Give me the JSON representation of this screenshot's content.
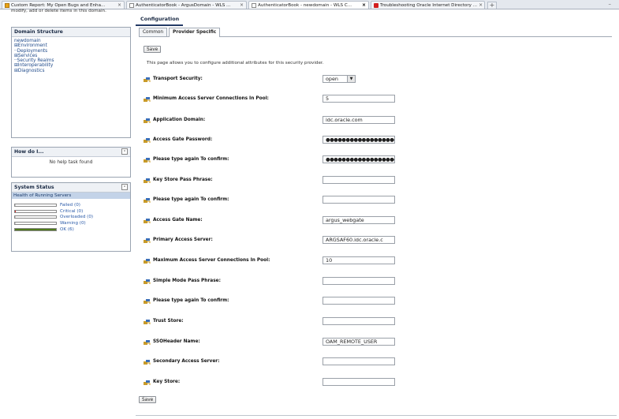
{
  "browser": {
    "tabs": [
      {
        "label": "Custom Report: My Open Bugs and Enha...",
        "icon_color": "#e8a317"
      },
      {
        "label": "AuthenticatorBook - ArgusDomain - WLS ...",
        "icon_color": "#ffffff"
      },
      {
        "label": "AuthenticatorBook - newdomain - WLS C...",
        "icon_color": "#ffffff"
      },
      {
        "label": "Troubleshooting Oracle Internet Directory ...",
        "icon_color": "#d21e1e"
      }
    ],
    "new_tab": "+",
    "close_glyph": "×",
    "minimize": "–"
  },
  "sidebar": {
    "top_text": "modify, add or delete items in this domain.",
    "domain_structure": {
      "title": "Domain Structure",
      "items": [
        "newdomain",
        "⊞Environment",
        "··Deployments",
        "⊞Services",
        "··Security Realms",
        "⊞Interoperability",
        "⊞Diagnostics"
      ]
    },
    "how_do_i": {
      "title": "How do I...",
      "collapse": "⊟",
      "text": "No help task found"
    },
    "system_status": {
      "title": "System Status",
      "collapse": "⊟",
      "health_label": "Health of Running Servers",
      "rows": [
        {
          "label": "Failed (0)",
          "color": "#d0d0d0",
          "fraction": 0
        },
        {
          "label": "Critical (0)",
          "color": "#cc2222",
          "fraction": 0
        },
        {
          "label": "Overloaded (0)",
          "color": "#d0d0d0",
          "fraction": 0
        },
        {
          "label": "Warning (0)",
          "color": "#d0d0d0",
          "fraction": 0
        },
        {
          "label": "OK (6)",
          "color": "#4f7a1a",
          "fraction": 1
        }
      ]
    }
  },
  "main": {
    "title": "Configuration",
    "tabs": [
      {
        "label": "Common",
        "selected": false
      },
      {
        "label": "Provider Specific",
        "selected": true
      }
    ],
    "save_label": "Save",
    "description": "This page allows you to configure additional attributes for this security provider.",
    "fields": [
      {
        "label": "Transport Security:",
        "type": "select",
        "value": "open",
        "arrow": "▼"
      },
      {
        "label": "Minimum Access Server Connections In Pool:",
        "type": "text",
        "value": "5"
      },
      {
        "label": "Application Domain:",
        "type": "text",
        "value": "idc.oracle.com"
      },
      {
        "label": "Access Gate Password:",
        "type": "password",
        "value": "●●●●●●●●●●●●●●●●●●"
      },
      {
        "label": "Please type again To confirm:",
        "type": "password",
        "value": "●●●●●●●●●●●●●●●●●●"
      },
      {
        "label": "Key Store Pass Phrase:",
        "type": "text",
        "value": ""
      },
      {
        "label": "Please type again To confirm:",
        "type": "text",
        "value": ""
      },
      {
        "label": "Access Gate Name:",
        "type": "text",
        "value": "argus_webgate"
      },
      {
        "label": "Primary Access Server:",
        "type": "text",
        "value": "ARGSAF60.idc.oracle.c"
      },
      {
        "label": "Maximum Access Server Connections In Pool:",
        "type": "text",
        "value": "10"
      },
      {
        "label": "Simple Mode Pass Phrase:",
        "type": "text",
        "value": ""
      },
      {
        "label": "Please type again To confirm:",
        "type": "text",
        "value": ""
      },
      {
        "label": "Trust Store:",
        "type": "text",
        "value": ""
      },
      {
        "label": "SSOHeader Name:",
        "type": "text",
        "value": "OAM_REMOTE_USER"
      },
      {
        "label": "Secondary Access Server:",
        "type": "text",
        "value": ""
      },
      {
        "label": "Key Store:",
        "type": "text",
        "value": ""
      }
    ]
  },
  "colors": {
    "field_icon": "#c89b2a",
    "field_icon_accent": "#3b6fb8"
  }
}
